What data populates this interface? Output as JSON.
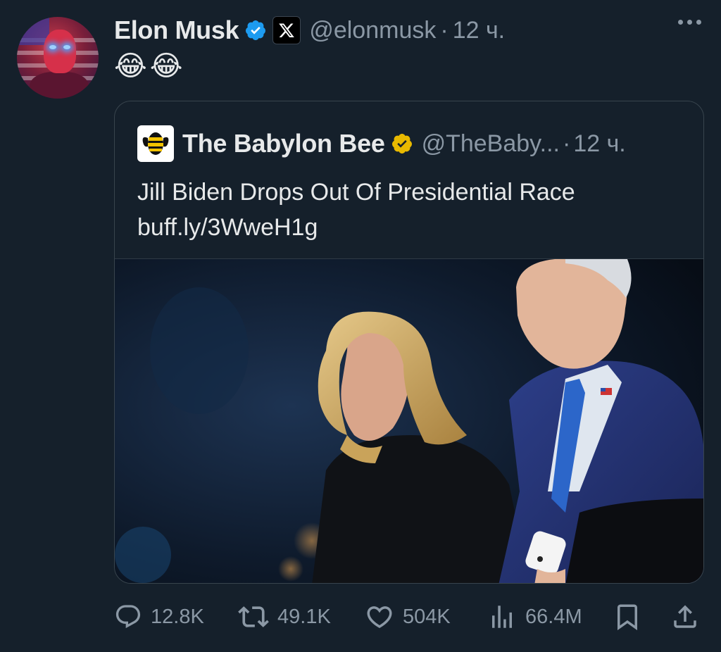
{
  "author": {
    "name": "Elon Musk",
    "handle": "@elonmusk",
    "separator": "·",
    "time": "12 ч."
  },
  "tweet": {
    "text": "😂😂"
  },
  "quoted": {
    "name": "The Babylon Bee",
    "handle": "@TheBaby...",
    "separator": "·",
    "time": "12 ч.",
    "text_line1": "Jill Biden Drops Out Of Presidential Race",
    "text_line2": "buff.ly/3WweH1g"
  },
  "actions": {
    "replies": "12.8K",
    "reposts": "49.1K",
    "likes": "504K",
    "views": "66.4M"
  },
  "icons": {
    "verified_color": "#1d9bf0",
    "gold_badge_color": "#e8b900",
    "muted_color": "#8b98a5",
    "background": "#15202b"
  }
}
